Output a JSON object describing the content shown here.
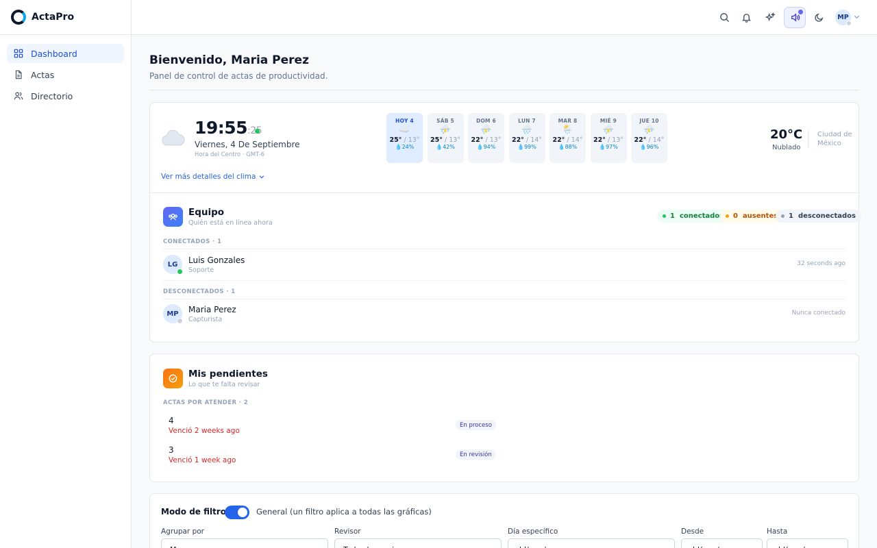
{
  "brand": {
    "name": "ActaPro"
  },
  "sidebar": {
    "items": [
      {
        "label": "Dashboard"
      },
      {
        "label": "Actas"
      },
      {
        "label": "Directorio"
      }
    ]
  },
  "topbar": {
    "avatar_initials": "MP"
  },
  "welcome": {
    "title": "Bienvenido, Maria Perez",
    "subtitle": "Panel de control de actas de productividad."
  },
  "weather": {
    "time_hm": "19:55",
    "time_s": ":25",
    "date": "Viernes, 4 De Septiembre",
    "timezone": "Hora del Centro · GMT-6",
    "more_link": "Ver más detalles del clima",
    "current_temp": "20°C",
    "current_desc": "Nublado",
    "city": "Ciudad de México",
    "forecast": [
      {
        "day": "HOY 4",
        "icon": "cloud-icon",
        "max": "25°",
        "min": "/ 13°",
        "rain": "24%"
      },
      {
        "day": "SÁB 5",
        "icon": "storm-icon",
        "max": "25°",
        "min": "/ 13°",
        "rain": "42%"
      },
      {
        "day": "DOM 6",
        "icon": "storm-icon",
        "max": "22°",
        "min": "/ 13°",
        "rain": "94%"
      },
      {
        "day": "LUN 7",
        "icon": "rain-icon",
        "max": "22°",
        "min": "/ 14°",
        "rain": "99%"
      },
      {
        "day": "MAR 8",
        "icon": "sun-rain-icon",
        "max": "22°",
        "min": "/ 14°",
        "rain": "88%"
      },
      {
        "day": "MIÉ 9",
        "icon": "storm-icon",
        "max": "22°",
        "min": "/ 13°",
        "rain": "97%"
      },
      {
        "day": "JUE 10",
        "icon": "storm-icon",
        "max": "22°",
        "min": "/ 14°",
        "rain": "96%"
      }
    ]
  },
  "team": {
    "title": "Equipo",
    "subtitle": "Quién está en línea ahora",
    "pills": [
      {
        "count": "1",
        "label": "conectados",
        "color": "#16a34a"
      },
      {
        "count": "0",
        "label": "ausentes",
        "color": "#d97706"
      },
      {
        "count": "1",
        "label": "desconectados",
        "color": "#475569"
      }
    ],
    "connected_label": "CONECTADOS · 1",
    "disconnected_label": "DESCONECTADOS · 1",
    "connected": [
      {
        "initials": "LG",
        "name": "Luis Gonzales",
        "role": "Soporte",
        "time": "32 seconds ago"
      }
    ],
    "disconnected": [
      {
        "initials": "MP",
        "name": "Maria Perez",
        "role": "Capturista",
        "time": "Nunca conectado"
      }
    ]
  },
  "pending": {
    "title": "Mis pendientes",
    "subtitle": "Lo que te falta revisar",
    "group_label": "ACTAS POR ATENDER · 2",
    "items": [
      {
        "number": "4",
        "due": "Venció 2 weeks ago",
        "status": "En proceso"
      },
      {
        "number": "3",
        "due": "Venció 1 week ago",
        "status": "En revisión"
      }
    ]
  },
  "filters": {
    "mode_label": "Modo de filtros:",
    "mode_value": "General (un filtro aplica a todas las gráficas)",
    "group_by": {
      "label": "Agrupar por",
      "value": "Mes"
    },
    "reviewer": {
      "label": "Revisor",
      "value": "Todos los revisores"
    },
    "day": {
      "label": "Día específico",
      "value": "dd/mm/aaaa"
    },
    "from": {
      "label": "Desde",
      "value": "dd/mm/aaaa"
    },
    "to": {
      "label": "Hasta",
      "value": "dd/mm/aaaa"
    }
  },
  "colors": {
    "accent": "#2563eb",
    "online": "#22c55e",
    "offline": "#cbd5e1",
    "overdue": "#dc2626"
  }
}
